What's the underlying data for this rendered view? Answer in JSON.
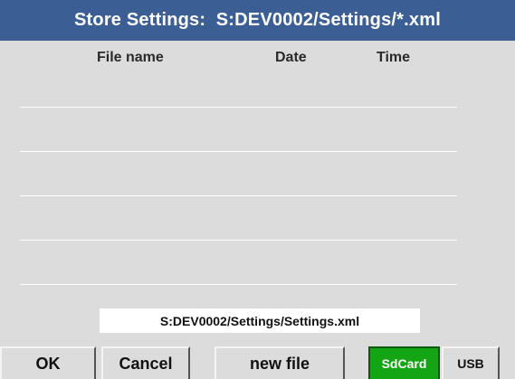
{
  "window": {
    "title": "Store Settings:  S:DEV0002/Settings/*.xml"
  },
  "file_table": {
    "columns": [
      "File name",
      "Date",
      "Time"
    ],
    "rows": [
      {
        "file_name": "",
        "date": "",
        "time": ""
      },
      {
        "file_name": "",
        "date": "",
        "time": ""
      },
      {
        "file_name": "",
        "date": "",
        "time": ""
      },
      {
        "file_name": "",
        "date": "",
        "time": ""
      },
      {
        "file_name": "",
        "date": "",
        "time": ""
      }
    ]
  },
  "target_path": "S:DEV0002/Settings/Settings.xml",
  "buttons": {
    "ok": "OK",
    "cancel": "Cancel",
    "new_file": "new file",
    "sdcard": "SdCard",
    "usb": "USB"
  },
  "storage": {
    "selected": "SdCard"
  },
  "colors": {
    "title_bar": "#3b5f95",
    "background": "#dcdcdc",
    "sdcard_active": "#14a514"
  }
}
